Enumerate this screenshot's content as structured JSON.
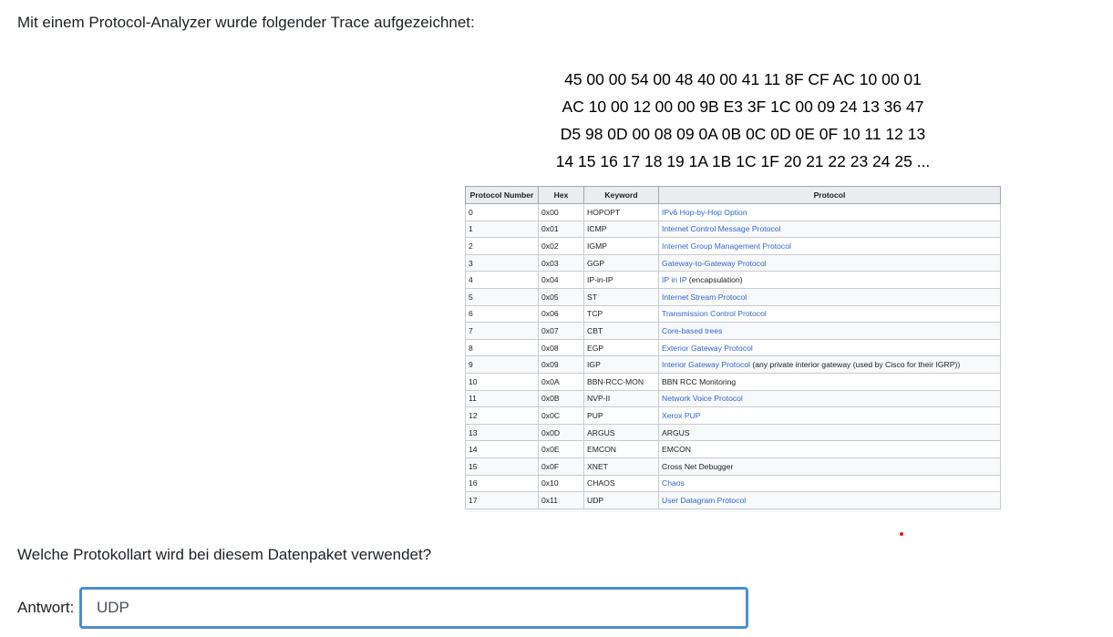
{
  "intro_text": "Mit einem Protocol-Analyzer wurde folgender Trace aufgezeichnet:",
  "hex_dump": [
    "45 00 00 54 00 48 40 00 41 11 8F CF AC 10 00 01",
    "AC 10 00 12 00 00 9B E3 3F 1C 00 09 24 13 36 47",
    "D5 98 0D 00 08 09 0A 0B 0C 0D 0E 0F 10 11 12 13",
    "14 15 16 17 18 19 1A 1B 1C 1F 20 21 22 23 24 25 ..."
  ],
  "table": {
    "headers": [
      "Protocol Number",
      "Hex",
      "Keyword",
      "Protocol"
    ],
    "rows": [
      {
        "num": "0",
        "hex": "0x00",
        "kw": "HOPOPT",
        "proto": "IPv6 Hop-by-Hop Option",
        "proto_suffix": ""
      },
      {
        "num": "1",
        "hex": "0x01",
        "kw": "ICMP",
        "proto": "Internet Control Message Protocol",
        "proto_suffix": ""
      },
      {
        "num": "2",
        "hex": "0x02",
        "kw": "IGMP",
        "proto": "Internet Group Management Protocol",
        "proto_suffix": ""
      },
      {
        "num": "3",
        "hex": "0x03",
        "kw": "GGP",
        "proto": "Gateway-to-Gateway Protocol",
        "proto_suffix": ""
      },
      {
        "num": "4",
        "hex": "0x04",
        "kw": "IP-in-IP",
        "proto": "IP in IP",
        "proto_suffix": " (encapsulation)"
      },
      {
        "num": "5",
        "hex": "0x05",
        "kw": "ST",
        "proto": "Internet Stream Protocol",
        "proto_suffix": ""
      },
      {
        "num": "6",
        "hex": "0x06",
        "kw": "TCP",
        "proto": "Transmission Control Protocol",
        "proto_suffix": ""
      },
      {
        "num": "7",
        "hex": "0x07",
        "kw": "CBT",
        "proto": "Core-based trees",
        "proto_suffix": ""
      },
      {
        "num": "8",
        "hex": "0x08",
        "kw": "EGP",
        "proto": "Exterior Gateway Protocol",
        "proto_suffix": ""
      },
      {
        "num": "9",
        "hex": "0x09",
        "kw": "IGP",
        "proto": "Interior Gateway Protocol",
        "proto_suffix": " (any private interior gateway (used by Cisco for their IGRP))"
      },
      {
        "num": "10",
        "hex": "0x0A",
        "kw": "BBN-RCC-MON",
        "proto": "",
        "proto_suffix": "BBN RCC Monitoring"
      },
      {
        "num": "11",
        "hex": "0x0B",
        "kw": "NVP-II",
        "proto": "Network Voice Protocol",
        "proto_suffix": ""
      },
      {
        "num": "12",
        "hex": "0x0C",
        "kw": "PUP",
        "proto": "Xerox PUP",
        "proto_suffix": ""
      },
      {
        "num": "13",
        "hex": "0x0D",
        "kw": "ARGUS",
        "proto": "",
        "proto_suffix": "ARGUS"
      },
      {
        "num": "14",
        "hex": "0x0E",
        "kw": "EMCON",
        "proto": "",
        "proto_suffix": "EMCON"
      },
      {
        "num": "15",
        "hex": "0x0F",
        "kw": "XNET",
        "proto": "",
        "proto_suffix": "Cross Net Debugger"
      },
      {
        "num": "16",
        "hex": "0x10",
        "kw": "CHAOS",
        "proto": "Chaos",
        "proto_suffix": ""
      },
      {
        "num": "17",
        "hex": "0x11",
        "kw": "UDP",
        "proto": "User Datagram Protocol",
        "proto_suffix": ""
      }
    ]
  },
  "question_text": "Welche Protokollart wird bei diesem Datenpaket verwendet?",
  "answer": {
    "label": "Antwort:",
    "value": "UDP"
  },
  "colors": {
    "link": "#3366cc",
    "input_border": "#4c8fd1",
    "marker_dot": "#e0191a"
  }
}
